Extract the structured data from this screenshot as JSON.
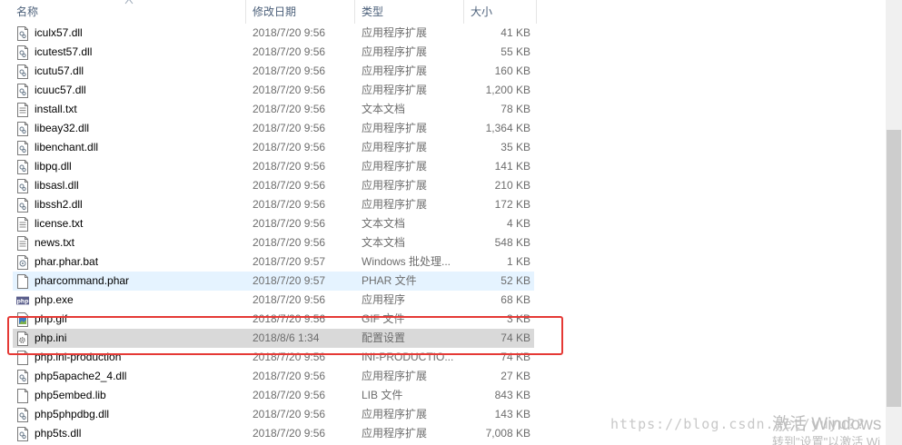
{
  "columns": {
    "name": "名称",
    "date": "修改日期",
    "type": "类型",
    "size": "大小"
  },
  "files": [
    {
      "name": "iculx57.dll",
      "date": "2018/7/20 9:56",
      "type": "应用程序扩展",
      "size": "41 KB",
      "icon": "dll-icon",
      "state": ""
    },
    {
      "name": "icutest57.dll",
      "date": "2018/7/20 9:56",
      "type": "应用程序扩展",
      "size": "55 KB",
      "icon": "dll-icon",
      "state": ""
    },
    {
      "name": "icutu57.dll",
      "date": "2018/7/20 9:56",
      "type": "应用程序扩展",
      "size": "160 KB",
      "icon": "dll-icon",
      "state": ""
    },
    {
      "name": "icuuc57.dll",
      "date": "2018/7/20 9:56",
      "type": "应用程序扩展",
      "size": "1,200 KB",
      "icon": "dll-icon",
      "state": ""
    },
    {
      "name": "install.txt",
      "date": "2018/7/20 9:56",
      "type": "文本文档",
      "size": "78 KB",
      "icon": "text-file-icon",
      "state": ""
    },
    {
      "name": "libeay32.dll",
      "date": "2018/7/20 9:56",
      "type": "应用程序扩展",
      "size": "1,364 KB",
      "icon": "dll-icon",
      "state": ""
    },
    {
      "name": "libenchant.dll",
      "date": "2018/7/20 9:56",
      "type": "应用程序扩展",
      "size": "35 KB",
      "icon": "dll-icon",
      "state": ""
    },
    {
      "name": "libpq.dll",
      "date": "2018/7/20 9:56",
      "type": "应用程序扩展",
      "size": "141 KB",
      "icon": "dll-icon",
      "state": ""
    },
    {
      "name": "libsasl.dll",
      "date": "2018/7/20 9:56",
      "type": "应用程序扩展",
      "size": "210 KB",
      "icon": "dll-icon",
      "state": ""
    },
    {
      "name": "libssh2.dll",
      "date": "2018/7/20 9:56",
      "type": "应用程序扩展",
      "size": "172 KB",
      "icon": "dll-icon",
      "state": ""
    },
    {
      "name": "license.txt",
      "date": "2018/7/20 9:56",
      "type": "文本文档",
      "size": "4 KB",
      "icon": "text-file-icon",
      "state": ""
    },
    {
      "name": "news.txt",
      "date": "2018/7/20 9:56",
      "type": "文本文档",
      "size": "548 KB",
      "icon": "text-file-icon",
      "state": ""
    },
    {
      "name": "phar.phar.bat",
      "date": "2018/7/20 9:57",
      "type": "Windows 批处理...",
      "size": "1 KB",
      "icon": "batch-file-icon",
      "state": ""
    },
    {
      "name": "pharcommand.phar",
      "date": "2018/7/20 9:57",
      "type": "PHAR 文件",
      "size": "52 KB",
      "icon": "blank-file-icon",
      "state": "hover"
    },
    {
      "name": "php.exe",
      "date": "2018/7/20 9:56",
      "type": "应用程序",
      "size": "68 KB",
      "icon": "php-exe-icon",
      "state": ""
    },
    {
      "name": "php.gif",
      "date": "2018/7/20 9:56",
      "type": "GIF 文件",
      "size": "3 KB",
      "icon": "image-file-icon",
      "state": ""
    },
    {
      "name": "php.ini",
      "date": "2018/8/6 1:34",
      "type": "配置设置",
      "size": "74 KB",
      "icon": "config-file-icon",
      "state": "selected"
    },
    {
      "name": "php.ini-production",
      "date": "2018/7/20 9:56",
      "type": "INI-PRODUCTIO...",
      "size": "74 KB",
      "icon": "blank-file-icon",
      "state": ""
    },
    {
      "name": "php5apache2_4.dll",
      "date": "2018/7/20 9:56",
      "type": "应用程序扩展",
      "size": "27 KB",
      "icon": "dll-icon",
      "state": ""
    },
    {
      "name": "php5embed.lib",
      "date": "2018/7/20 9:56",
      "type": "LIB 文件",
      "size": "843 KB",
      "icon": "blank-file-icon",
      "state": ""
    },
    {
      "name": "php5phpdbg.dll",
      "date": "2018/7/20 9:56",
      "type": "应用程序扩展",
      "size": "143 KB",
      "icon": "dll-icon",
      "state": ""
    },
    {
      "name": "php5ts.dll",
      "date": "2018/7/20 9:56",
      "type": "应用程序扩展",
      "size": "7,008 KB",
      "icon": "dll-icon",
      "state": ""
    }
  ],
  "watermark": {
    "url": "https://blog.csdn.net/yuyu??",
    "activate_title": "激活 Windows",
    "activate_sub": "转到\"设置\"以激活 Wi"
  },
  "colors": {
    "highlight_border": "#e53935",
    "hover_row": "#e5f3ff",
    "selected_row": "#d9d9d9"
  }
}
